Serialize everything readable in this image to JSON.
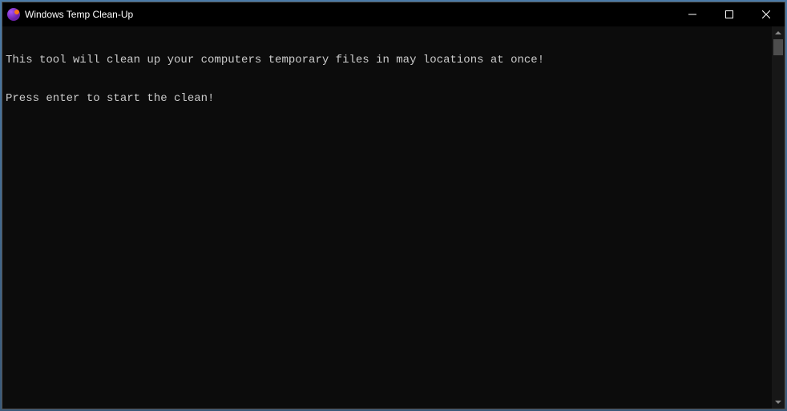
{
  "window": {
    "title": "Windows Temp Clean-Up"
  },
  "console": {
    "line1": "This tool will clean up your computers temporary files in may locations at once!",
    "line2": "Press enter to start the clean!"
  }
}
